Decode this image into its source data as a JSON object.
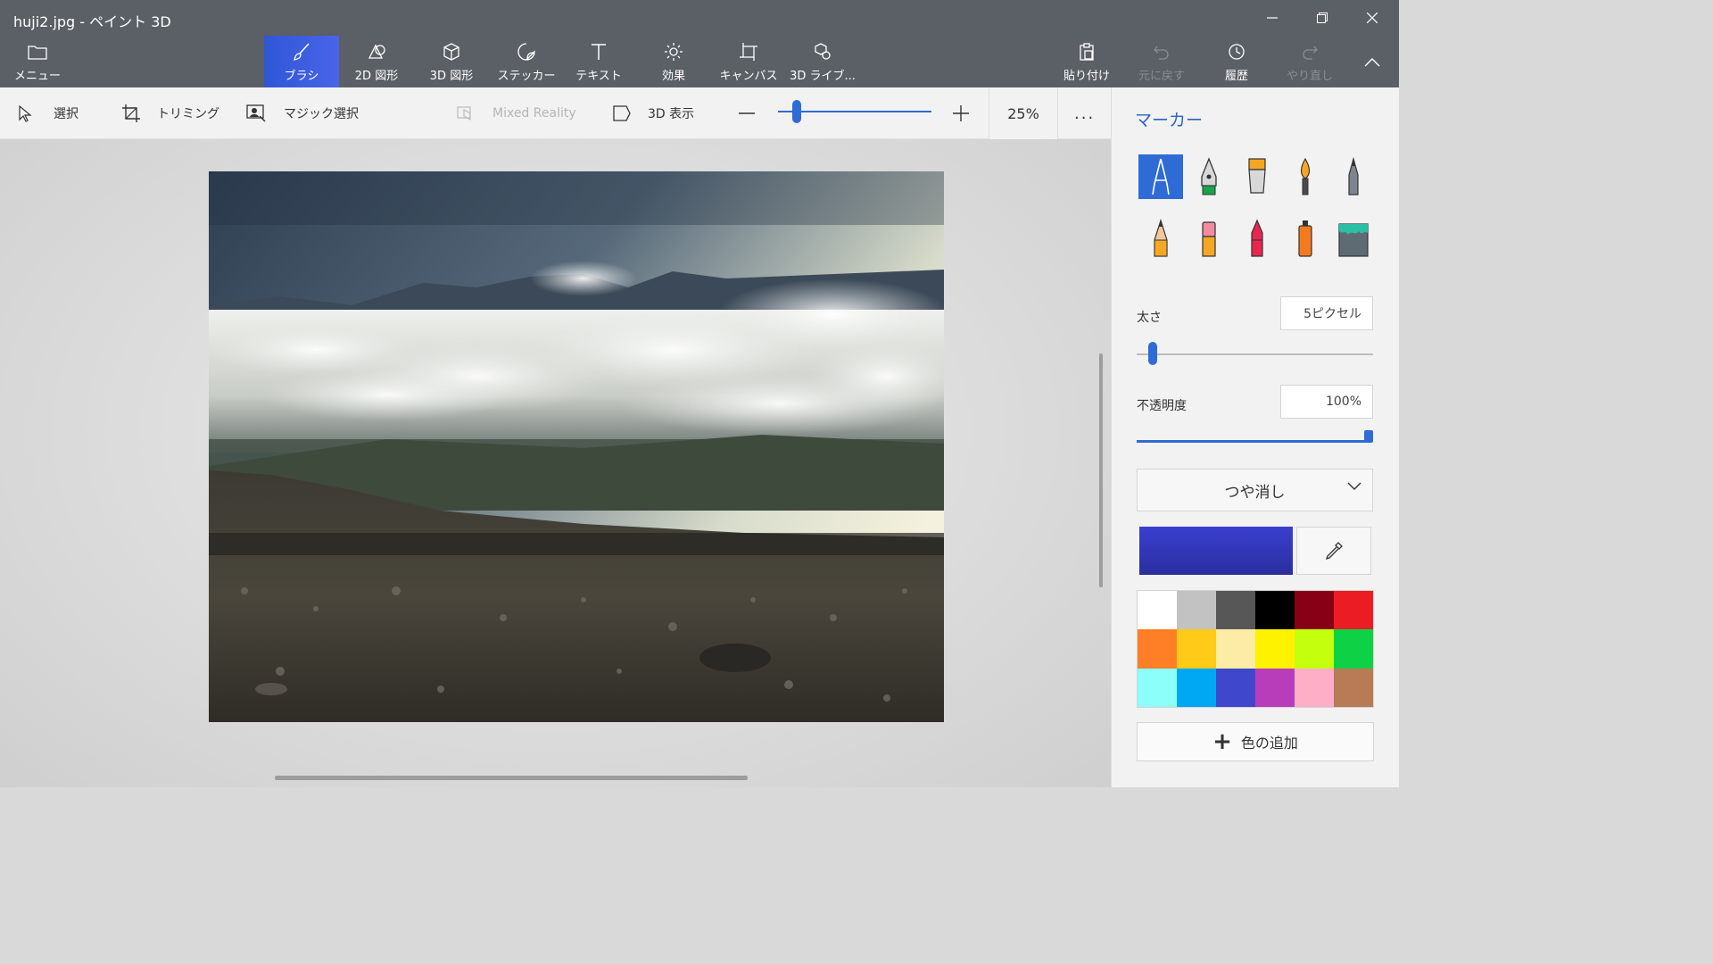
{
  "window": {
    "title": "huji2.jpg - ペイント 3D"
  },
  "ribbon": {
    "menu_label": "メニュー",
    "tabs": [
      {
        "label": "ブラシ",
        "active": true
      },
      {
        "label": "2D 図形"
      },
      {
        "label": "3D 図形"
      },
      {
        "label": "ステッカー"
      },
      {
        "label": "テキスト"
      },
      {
        "label": "効果"
      },
      {
        "label": "キャンバス"
      },
      {
        "label": "3D ライブ..."
      }
    ],
    "actions": {
      "paste": "貼り付け",
      "undo": "元に戻す",
      "history": "履歴",
      "redo": "やり直し"
    }
  },
  "toolbar": {
    "select": "選択",
    "crop": "トリミング",
    "magic_select": "マジック選択",
    "mixed_reality": "Mixed Reality",
    "view_3d": "3D 表示",
    "zoom": "25%",
    "zoom_level": 0.1,
    "more": "..."
  },
  "panel": {
    "title": "マーカー",
    "brushes": [
      {
        "name": "marker",
        "selected": true
      },
      {
        "name": "calligraphy-pen"
      },
      {
        "name": "oil-brush"
      },
      {
        "name": "watercolor"
      },
      {
        "name": "pixel-pen"
      },
      {
        "name": "pencil"
      },
      {
        "name": "eraser"
      },
      {
        "name": "crayon"
      },
      {
        "name": "spray-can"
      },
      {
        "name": "fill"
      }
    ],
    "thickness_label": "太さ",
    "thickness_value": "5ピクセル",
    "thickness_level": 0.05,
    "opacity_label": "不透明度",
    "opacity_value": "100%",
    "opacity_level": 1.0,
    "finish": "つや消し",
    "current_color": "#3a3fd0",
    "palette": [
      "#ffffff",
      "#c2c2c2",
      "#575757",
      "#000000",
      "#880015",
      "#ec1c24",
      "#ff7f27",
      "#ffca18",
      "#fdeca6",
      "#fff200",
      "#c4ff0e",
      "#0ed145",
      "#8cfffb",
      "#00a8f3",
      "#3f48cc",
      "#b83dba",
      "#ffaec8",
      "#b97a56"
    ],
    "add_color": "色の追加"
  },
  "colors": {
    "accent": "#2e6bd6",
    "ribbon_bg": "#5b5f66"
  }
}
